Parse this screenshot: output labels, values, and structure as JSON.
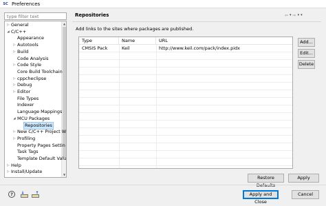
{
  "window": {
    "app_icon": "SC",
    "title": "Preferences"
  },
  "filter": {
    "placeholder": "type filter text"
  },
  "tree": [
    {
      "label": "General",
      "arrow": "▷",
      "depth": 0
    },
    {
      "label": "C/C++",
      "arrow": "◢",
      "depth": 0
    },
    {
      "label": "Appearance",
      "arrow": "",
      "depth": 1
    },
    {
      "label": "Autotools",
      "arrow": "▷",
      "depth": 1
    },
    {
      "label": "Build",
      "arrow": "▷",
      "depth": 1
    },
    {
      "label": "Code Analysis",
      "arrow": "",
      "depth": 1
    },
    {
      "label": "Code Style",
      "arrow": "▷",
      "depth": 1
    },
    {
      "label": "Core Build Toolchain",
      "arrow": "",
      "depth": 1
    },
    {
      "label": "cppcheclipse",
      "arrow": "▷",
      "depth": 1
    },
    {
      "label": "Debug",
      "arrow": "▷",
      "depth": 1
    },
    {
      "label": "Editor",
      "arrow": "▷",
      "depth": 1
    },
    {
      "label": "File Types",
      "arrow": "",
      "depth": 1
    },
    {
      "label": "Indexer",
      "arrow": "",
      "depth": 1
    },
    {
      "label": "Language Mappings",
      "arrow": "",
      "depth": 1
    },
    {
      "label": "MCU Packages",
      "arrow": "◢",
      "depth": 1
    },
    {
      "label": "Repositories",
      "arrow": "",
      "depth": 2,
      "selected": true
    },
    {
      "label": "New C/C++ Project W",
      "arrow": "▷",
      "depth": 1
    },
    {
      "label": "Profiling",
      "arrow": "▷",
      "depth": 1
    },
    {
      "label": "Property Pages Settin",
      "arrow": "",
      "depth": 1
    },
    {
      "label": "Task Tags",
      "arrow": "",
      "depth": 1
    },
    {
      "label": "Template Default Valu",
      "arrow": "",
      "depth": 1
    },
    {
      "label": "Help",
      "arrow": "▷",
      "depth": 0
    },
    {
      "label": "Install/Update",
      "arrow": "▷",
      "depth": 0
    }
  ],
  "page": {
    "title": "Repositories",
    "description": "Add links to the sites where packages are published."
  },
  "nav": {
    "back": "⇦",
    "forward": "⇨",
    "menu": "▾"
  },
  "table": {
    "columns": [
      "Type",
      "Name",
      "URL"
    ],
    "rows": [
      [
        "CMSIS Pack",
        "Keil",
        "http://www.keil.com/pack/index.pidx"
      ]
    ]
  },
  "buttons": {
    "add": "Add...",
    "edit": "Edit...",
    "delete": "Delete",
    "restore_defaults": "Restore Defaults",
    "apply": "Apply",
    "apply_close": "Apply and Close",
    "cancel": "Cancel"
  },
  "bottom_icons": {
    "help": "?"
  }
}
